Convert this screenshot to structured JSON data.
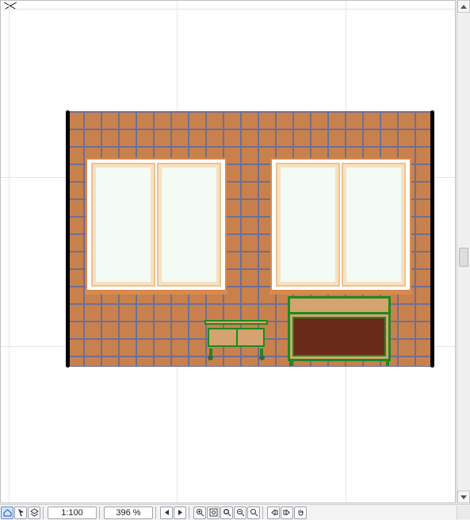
{
  "canvas": {
    "grid_vertical_positions": [
      10,
      222,
      435
    ],
    "grid_horizontal_positions": [
      10,
      222,
      435
    ],
    "wall": {
      "color_fill": "#c8814d",
      "color_grid": "#6f6f94",
      "left_post": true,
      "right_post": true
    },
    "windows": [
      {
        "id": "window-left",
        "panes": 2
      },
      {
        "id": "window-right",
        "panes": 2
      }
    ],
    "furniture": [
      {
        "id": "small-cart",
        "type": "cart",
        "color_frame": "#1d8a1d"
      },
      {
        "id": "cabinet",
        "type": "cabinet",
        "color_frame": "#1d8a1d",
        "color_door": "#6a2a1a"
      }
    ]
  },
  "statusbar": {
    "mode_buttons": [
      {
        "icon": "home-icon",
        "active": true
      },
      {
        "icon": "cursor-icon",
        "active": false
      },
      {
        "icon": "layers-icon",
        "active": false
      }
    ],
    "scale_label": "1:100",
    "zoom_label": "396 %",
    "nav_buttons": [
      "nav-prev",
      "nav-next"
    ],
    "zoom_buttons": [
      "zoom-in-icon",
      "zoom-fit-icon",
      "zoom-selection-icon",
      "zoom-out-icon",
      "zoom-region-icon",
      "pan-left-icon",
      "pan-right-icon",
      "pan-tool-icon"
    ]
  },
  "scroll": {
    "v_thumb_pos_pct": 49
  }
}
